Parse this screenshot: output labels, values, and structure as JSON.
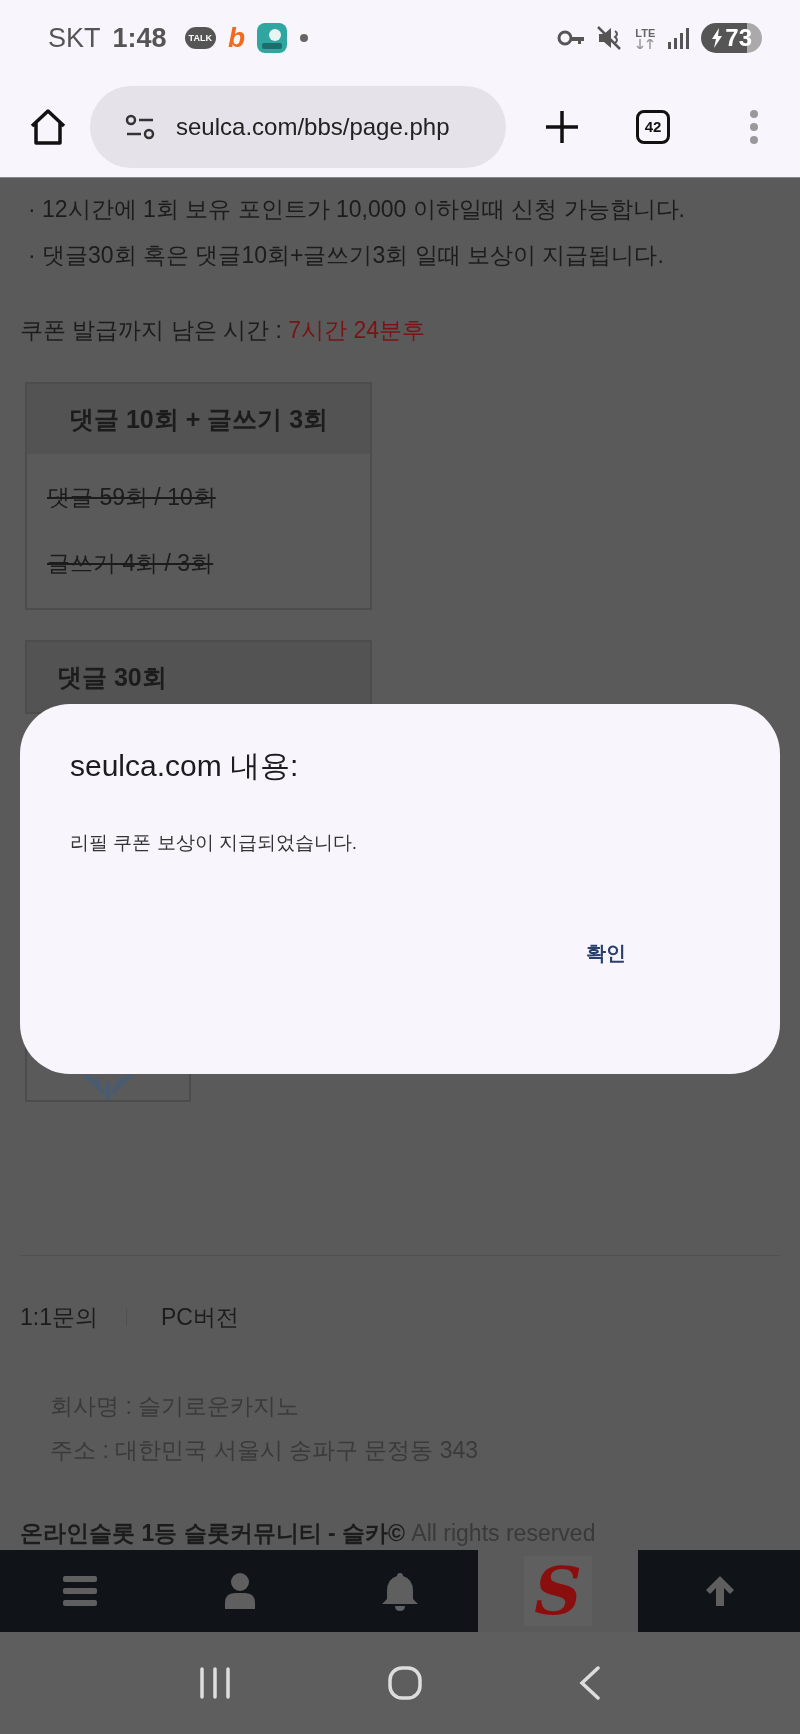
{
  "status_bar": {
    "carrier": "SKT",
    "time": "1:48",
    "notification_icons": [
      {
        "kind": "talk",
        "text": "TALK"
      },
      {
        "kind": "letter",
        "text": "b"
      },
      {
        "kind": "app"
      },
      {
        "kind": "more"
      }
    ],
    "network": "LTE",
    "battery": "73",
    "charging": true
  },
  "browser": {
    "url": "seulca.com/bbs/page.php",
    "tab_count": "42"
  },
  "page": {
    "notes": [
      "· 12시간에 1회 보유 포인트가 10,000 이하일때 신청 가능합니다.",
      "· 댓글30회 혹은 댓글10회+글쓰기3회 일때 보상이 지급됩니다."
    ],
    "countdown_label": "쿠폰 발급까지 남은 시간 :",
    "countdown_value": "7시간 24분후",
    "cards": [
      {
        "title": "댓글 10회 + 글쓰기 3회",
        "requirements": [
          {
            "text": "댓글 59회 / 10회",
            "done": true
          },
          {
            "text": "글쓰기 4회 / 3회",
            "done": true
          }
        ]
      },
      {
        "title": "댓글 30회"
      }
    ],
    "footer_links": [
      "1:1문의",
      "PC버전"
    ],
    "company": [
      "회사명 : 슬기로운카지노",
      "주소 : 대한민국 서울시 송파구 문정동 343"
    ],
    "copyright": "**온라인슬롯 1등 슬롯커뮤니티 - 슬카©** All rights reserved"
  },
  "dialog": {
    "title": "seulca.com 내용:",
    "message": "리필 쿠폰 보상이 지급되었습니다.",
    "button": "확인"
  },
  "bottom_nav": {
    "items": [
      {
        "kind": "menu"
      },
      {
        "kind": "user"
      },
      {
        "kind": "bell"
      },
      {
        "kind": "logo",
        "text": "S"
      },
      {
        "kind": "up"
      }
    ]
  }
}
